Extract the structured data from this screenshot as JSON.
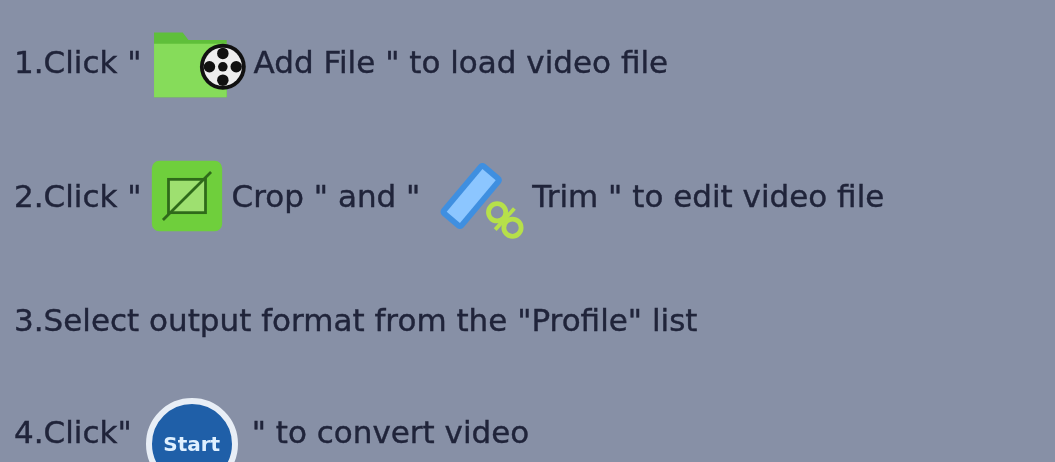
{
  "steps": [
    {
      "parts": [
        {
          "kind": "text",
          "text": "1.Click \""
        },
        {
          "kind": "add-file-icon"
        },
        {
          "kind": "text",
          "text": "Add File \" to load video file"
        }
      ]
    },
    {
      "parts": [
        {
          "kind": "text",
          "text": "2.Click \""
        },
        {
          "kind": "crop-icon"
        },
        {
          "kind": "text",
          "text": "Crop \" and \""
        },
        {
          "kind": "trim-icon"
        },
        {
          "kind": "text",
          "text": "Trim \" to edit video file"
        }
      ]
    },
    {
      "parts": [
        {
          "kind": "text",
          "text": "3.Select output format from the \"Profile\" list"
        }
      ]
    },
    {
      "parts": [
        {
          "kind": "text",
          "text": "4.Click\""
        },
        {
          "kind": "start-button",
          "label": "Start"
        },
        {
          "kind": "text",
          "text": "\" to convert video"
        }
      ]
    }
  ]
}
